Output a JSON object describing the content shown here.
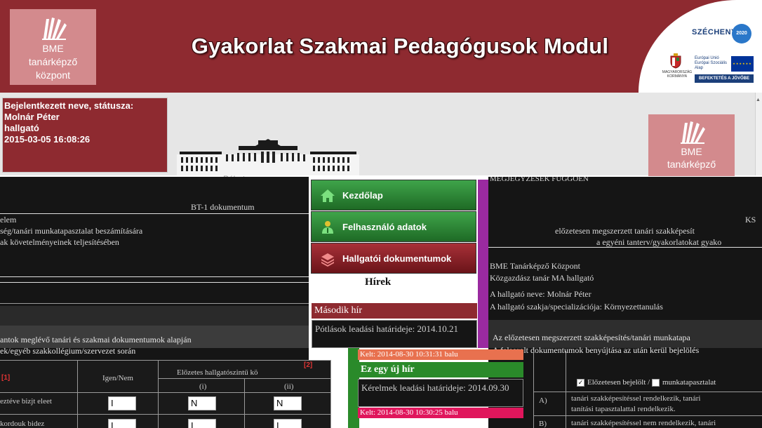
{
  "header": {
    "logo_lines": [
      "BME",
      "tanárképző",
      "központ"
    ],
    "title": "Gyakorlat Szakmai Pedagógusok Modul",
    "szechenyi": {
      "title": "SZÉCHENYI",
      "year": "2020",
      "gov": "MAGYARORSZÁG KORMÁNYA",
      "eu_lines": [
        "Európai Unió",
        "Európai Szociális",
        "Alap"
      ],
      "slogan": "BEFEKTETÉS A JÖVŐBE"
    }
  },
  "status": {
    "label": "Bejelentkezett neve, státusza:",
    "name": "Molnár Péter",
    "role": "hallgató",
    "timestamp": "2015-03-05 16:08:26"
  },
  "logo2_lines": [
    "BME",
    "tanárképző"
  ],
  "building_label": "Pébat",
  "left_content": {
    "doc_title": "BT-1 dokumentum",
    "line1": "elem",
    "line2": "ség/tanári munkatapasztalat beszámítására",
    "line3": "ak követelményeinek teljesítésében",
    "line4": "antok meglévő tanári és szakmai dokumentumok alapján",
    "line5": "ek/egyéb szakkollégium/szervezet során"
  },
  "table": {
    "col_mark": "[1]",
    "col_yesno": "Igen/Nem",
    "col_prior": "Előzetes hallgatószintű kö",
    "col_prior_mark": "[2]",
    "sub_a": "(i)",
    "sub_b": "(ii)",
    "row1_label": "eztéve bizjt eleet",
    "row2_label": "kordouk bidez",
    "row1_values": [
      "I",
      "N",
      "N"
    ],
    "row2_values": [
      "I",
      "I",
      "I"
    ]
  },
  "menu": [
    {
      "label": "Kezdőlap",
      "icon": "home-icon",
      "style": "green"
    },
    {
      "label": "Felhasználó adatok",
      "icon": "user-icon",
      "style": "green"
    },
    {
      "label": "Hallgatói dokumentumok",
      "icon": "layers-icon",
      "style": "red"
    }
  ],
  "news": {
    "section_title": "Hírek",
    "item1": {
      "title": "Második hír",
      "body": "Pótlások leadási határideje: 2014.10.21",
      "kelt": "Kelt: 2014-08-30 10:31:31 balu"
    },
    "item2": {
      "title": "Ez egy új hír",
      "body": "Kérelmek leadási határideje: 2014.09.30",
      "kelt": "Kelt: 2014-08-30 10:30:25 balu"
    }
  },
  "right_content": {
    "topline": "MEGJEGYZÉSEK FÜGGŐEN",
    "k_mark": "KS",
    "line1": "előzetesen megszerzett tanári szakképesít",
    "line2": "a egyéni tanterv/gyakorlatokat gyako",
    "line3": "BME Tanárképző Központ",
    "line4": "Közgazdász tanár MA hallgató",
    "line5": "A hallgató neve: Molnár Péter",
    "line6": "A hallgató szakja/specializációja: Környezettanulás",
    "line7": "Az előzetesen megszerzett szakképesítés/tanári munkatapa",
    "line8": "A felsorolt dokumentumok benyújtása az után kerül bejelölés",
    "row_a": "A)",
    "row_b": "B)",
    "row_a_text1": "tanári szakképesítéssel rendelkezik, tanári",
    "row_a_text2": "tanítási tapasztalattal rendelkezik.",
    "row_b_text1": "tanári szakképesítéssel nem rendelkezik, tanári",
    "chk_a": "Előzetesen bejelölt",
    "chk_sep": "/",
    "chk_b": "munkatapasztalat"
  },
  "colors": {
    "brand_red": "#8e2a30",
    "menu_green": "#2a8a2a",
    "accent_purple": "#9a2aa0",
    "kelt_orange": "#e8714f",
    "kelt_pink": "#e0165c"
  }
}
